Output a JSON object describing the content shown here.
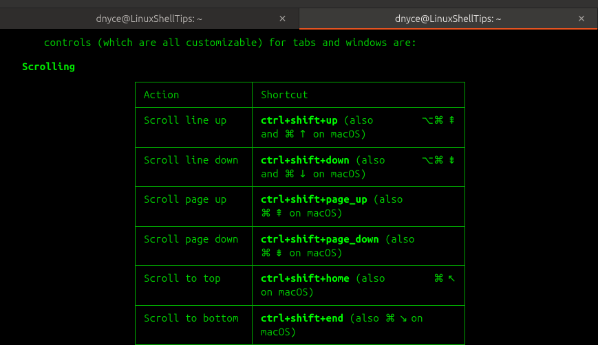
{
  "tabs": [
    {
      "title": "dnyce@LinuxShellTips: ~",
      "active": false
    },
    {
      "title": "dnyce@LinuxShellTips: ~",
      "active": true
    }
  ],
  "intro_line": "controls (which are all customizable) for tabs and windows are:",
  "section_title": "Scrolling",
  "table": {
    "headers": {
      "action": "Action",
      "shortcut": "Shortcut"
    },
    "rows": [
      {
        "action": "Scroll line up",
        "kbd": "ctrl+shift+up",
        "also_prefix": "  (also ",
        "sym_right": "⌥⌘ ⇞",
        "line2_pre": "and ",
        "line2_sym": "⌘ ↑",
        "line2_post": " on macOS)"
      },
      {
        "action": "Scroll line down",
        "kbd": "ctrl+shift+down",
        "also_prefix": " (also ",
        "sym_right": "⌥⌘ ⇟",
        "line2_pre": "and ",
        "line2_sym": "⌘ ↓",
        "line2_post": " on macOS)"
      },
      {
        "action": "Scroll page up",
        "kbd": "ctrl+shift+page_up",
        "also_prefix": "   (also",
        "sym_right": "",
        "line2_pre": "",
        "line2_sym": "⌘ ⇞",
        "line2_post": " on macOS)"
      },
      {
        "action": "Scroll page down",
        "kbd": "ctrl+shift+page_down",
        "also_prefix": "  (also",
        "sym_right": "",
        "line2_pre": "",
        "line2_sym": "⌘ ⇟",
        "line2_post": " on macOS)"
      },
      {
        "action": "Scroll to top",
        "kbd": "ctrl+shift+home",
        "also_prefix": "  (also  ",
        "sym_right": "⌘ ↖",
        "line2_pre": "",
        "line2_sym": "",
        "line2_post": "on macOS)"
      },
      {
        "action": "Scroll to bottom",
        "kbd": "ctrl+shift+end",
        "also_prefix": " (also ",
        "sym_right": "",
        "line2_sym_inline": "⌘ ↘ ",
        "line2_post_inline": "on",
        "line2_pre": "",
        "line2_sym": "",
        "line2_post": "macOS)"
      }
    ]
  }
}
